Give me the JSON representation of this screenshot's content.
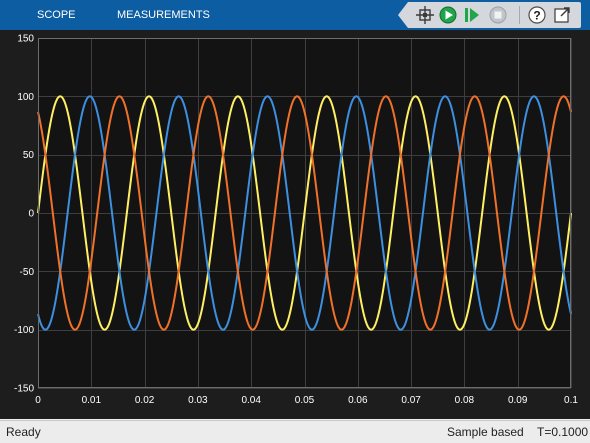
{
  "toolbar": {
    "tabs": [
      {
        "label": "SCOPE"
      },
      {
        "label": "MEASUREMENTS"
      }
    ],
    "icons": [
      "highlight-block-icon",
      "run-icon",
      "step-forward-icon",
      "stop-icon",
      "help-icon",
      "undock-icon"
    ],
    "background": "#0d5da3"
  },
  "status": {
    "state": "Ready",
    "mode": "Sample based",
    "time": "T=0.1000"
  },
  "chart_data": {
    "type": "line",
    "title": "",
    "xlabel": "",
    "ylabel": "",
    "xlim": [
      0,
      0.1
    ],
    "ylim": [
      -150,
      150
    ],
    "x_ticks": [
      0,
      0.01,
      0.02,
      0.03,
      0.04,
      0.05,
      0.06,
      0.07,
      0.08,
      0.09,
      0.1
    ],
    "x_tick_labels": [
      "0",
      "0.01",
      "0.02",
      "0.03",
      "0.04",
      "0.05",
      "0.06",
      "0.07",
      "0.08",
      "0.09",
      "0.1"
    ],
    "y_ticks": [
      -150,
      -100,
      -50,
      0,
      50,
      100,
      150
    ],
    "y_tick_labels": [
      "-150",
      "-100",
      "-50",
      "0",
      "50",
      "100",
      "150"
    ],
    "grid": true,
    "background": "#131313",
    "series": [
      {
        "amplitude": 100,
        "frequency_hz": 60,
        "phase_deg": 0,
        "color": "#ffef62"
      },
      {
        "amplitude": 100,
        "frequency_hz": 60,
        "phase_deg": -120,
        "color": "#3d8fe0"
      },
      {
        "amplitude": 100,
        "frequency_hz": 60,
        "phase_deg": 120,
        "color": "#f0712a"
      }
    ]
  }
}
